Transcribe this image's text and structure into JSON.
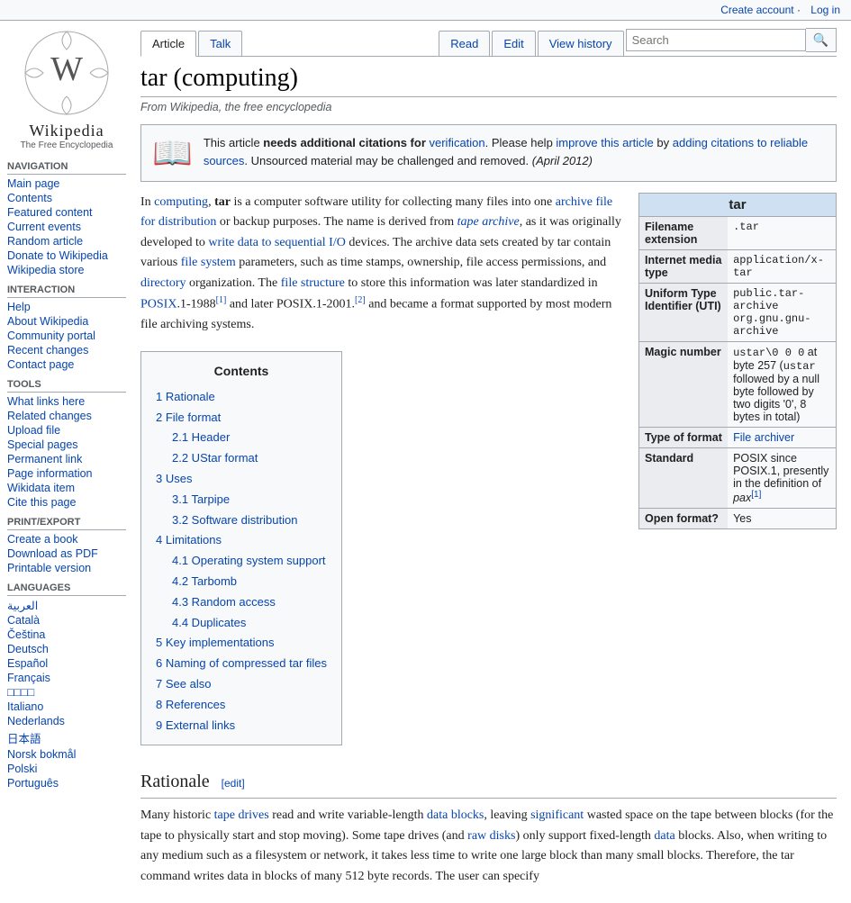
{
  "topbar": {
    "create_account": "Create account",
    "log_in": "Log in"
  },
  "logo": {
    "title": "Wikipedia",
    "subtitle": "The Free Encyclopedia"
  },
  "sidebar": {
    "navigation_heading": "Navigation",
    "items": [
      {
        "label": "Main page",
        "href": "#"
      },
      {
        "label": "Contents",
        "href": "#"
      },
      {
        "label": "Featured content",
        "href": "#"
      },
      {
        "label": "Current events",
        "href": "#"
      },
      {
        "label": "Random article",
        "href": "#"
      },
      {
        "label": "Donate to Wikipedia",
        "href": "#"
      },
      {
        "label": "Wikipedia store",
        "href": "#"
      }
    ],
    "interaction_heading": "Interaction",
    "interaction_items": [
      {
        "label": "Help",
        "href": "#"
      },
      {
        "label": "About Wikipedia",
        "href": "#"
      },
      {
        "label": "Community portal",
        "href": "#"
      },
      {
        "label": "Recent changes",
        "href": "#"
      },
      {
        "label": "Contact page",
        "href": "#"
      }
    ],
    "tools_heading": "Tools",
    "tools_items": [
      {
        "label": "What links here",
        "href": "#"
      },
      {
        "label": "Related changes",
        "href": "#"
      },
      {
        "label": "Upload file",
        "href": "#"
      },
      {
        "label": "Special pages",
        "href": "#"
      },
      {
        "label": "Permanent link",
        "href": "#"
      },
      {
        "label": "Page information",
        "href": "#"
      },
      {
        "label": "Wikidata item",
        "href": "#"
      },
      {
        "label": "Cite this page",
        "href": "#"
      }
    ],
    "print_heading": "Print/export",
    "print_items": [
      {
        "label": "Create a book",
        "href": "#"
      },
      {
        "label": "Download as PDF",
        "href": "#"
      },
      {
        "label": "Printable version",
        "href": "#"
      }
    ],
    "languages_heading": "Languages",
    "language_items": [
      {
        "label": "العربية",
        "href": "#"
      },
      {
        "label": "Català",
        "href": "#"
      },
      {
        "label": "Čeština",
        "href": "#"
      },
      {
        "label": "Deutsch",
        "href": "#"
      },
      {
        "label": "Español",
        "href": "#"
      },
      {
        "label": "Français",
        "href": "#"
      },
      {
        "label": "□□□□",
        "href": "#"
      },
      {
        "label": "Italiano",
        "href": "#"
      },
      {
        "label": "Nederlands",
        "href": "#"
      },
      {
        "label": "日本語",
        "href": "#"
      },
      {
        "label": "Norsk bokmål",
        "href": "#"
      },
      {
        "label": "Polski",
        "href": "#"
      },
      {
        "label": "Português",
        "href": "#"
      }
    ]
  },
  "tabs": {
    "article": "Article",
    "talk": "Talk",
    "read": "Read",
    "edit": "Edit",
    "view_history": "View history"
  },
  "search": {
    "placeholder": "Search",
    "button_icon": "🔍"
  },
  "article": {
    "title": "tar (computing)",
    "from_wiki": "From Wikipedia, the free encyclopedia",
    "notice": {
      "icon": "📖",
      "text_1": "This article ",
      "bold": "needs additional citations for",
      "link1": "verification",
      "text_2": ". Please help ",
      "link2": "improve this article",
      "text_3": " by ",
      "link3": "adding citations to reliable sources",
      "text_4": ". Unsourced material may be challenged and removed.",
      "date": " (April 2012)"
    },
    "infobox": {
      "title": "tar",
      "rows": [
        {
          "label": "Filename extension",
          "value": ".tar"
        },
        {
          "label": "Internet media type",
          "value": "application/x-tar"
        },
        {
          "label": "Uniform Type Identifier (UTI)",
          "value": "public.tar-archive org.gnu.gnu-archive"
        },
        {
          "label": "Magic number",
          "value": "ustar\\0 0 0 at byte 257 (ustar followed by a null byte followed by two digits '0', 8 bytes in total)"
        },
        {
          "label": "Type of format",
          "value": "File archiver",
          "link": true
        },
        {
          "label": "Standard",
          "value": "POSIX since POSIX.1, presently in the definition of pax[1]"
        },
        {
          "label": "Open format?",
          "value": "Yes"
        }
      ]
    },
    "intro_para": "In computing, tar is a computer software utility for collecting many files into one archive file for distribution or backup purposes. The name is derived from tape archive, as it was originally developed to write data to sequential I/O devices. The archive data sets created by tar contain various file system parameters, such as time stamps, ownership, file access permissions, and directory organization. The file structure to store this information was later standardized in POSIX.1-1988[1] and later POSIX.1-2001.[2] and became a format supported by most modern file archiving systems.",
    "toc": {
      "title": "Contents",
      "items": [
        {
          "num": "1",
          "label": "Rationale",
          "href": "#rationale"
        },
        {
          "num": "2",
          "label": "File format",
          "href": "#file-format",
          "subitems": [
            {
              "num": "2.1",
              "label": "Header",
              "href": "#header"
            },
            {
              "num": "2.2",
              "label": "UStar format",
              "href": "#ustar-format"
            }
          ]
        },
        {
          "num": "3",
          "label": "Uses",
          "href": "#uses",
          "subitems": [
            {
              "num": "3.1",
              "label": "Tarpipe",
              "href": "#tarpipe"
            },
            {
              "num": "3.2",
              "label": "Software distribution",
              "href": "#software-distribution"
            }
          ]
        },
        {
          "num": "4",
          "label": "Limitations",
          "href": "#limitations",
          "subitems": [
            {
              "num": "4.1",
              "label": "Operating system support",
              "href": "#os-support"
            },
            {
              "num": "4.2",
              "label": "Tarbomb",
              "href": "#tarbomb"
            },
            {
              "num": "4.3",
              "label": "Random access",
              "href": "#random-access"
            },
            {
              "num": "4.4",
              "label": "Duplicates",
              "href": "#duplicates"
            }
          ]
        },
        {
          "num": "5",
          "label": "Key implementations",
          "href": "#key-implementations"
        },
        {
          "num": "6",
          "label": "Naming of compressed tar files",
          "href": "#naming"
        },
        {
          "num": "7",
          "label": "See also",
          "href": "#see-also"
        },
        {
          "num": "8",
          "label": "References",
          "href": "#references"
        },
        {
          "num": "9",
          "label": "External links",
          "href": "#external-links"
        }
      ]
    },
    "rationale_heading": "Rationale",
    "rationale_edit": "[edit]",
    "rationale_para": "Many historic tape drives read and write variable-length data blocks, leaving significant wasted space on the tape between blocks (for the tape to physically start and stop moving). Some tape drives (and raw disks) only support fixed-length data blocks. Also, when writing to any medium such as a filesystem or network, it takes less time to write one large block than many small blocks. Therefore, the tar command writes data in blocks of many 512 byte records. The user can specify"
  }
}
